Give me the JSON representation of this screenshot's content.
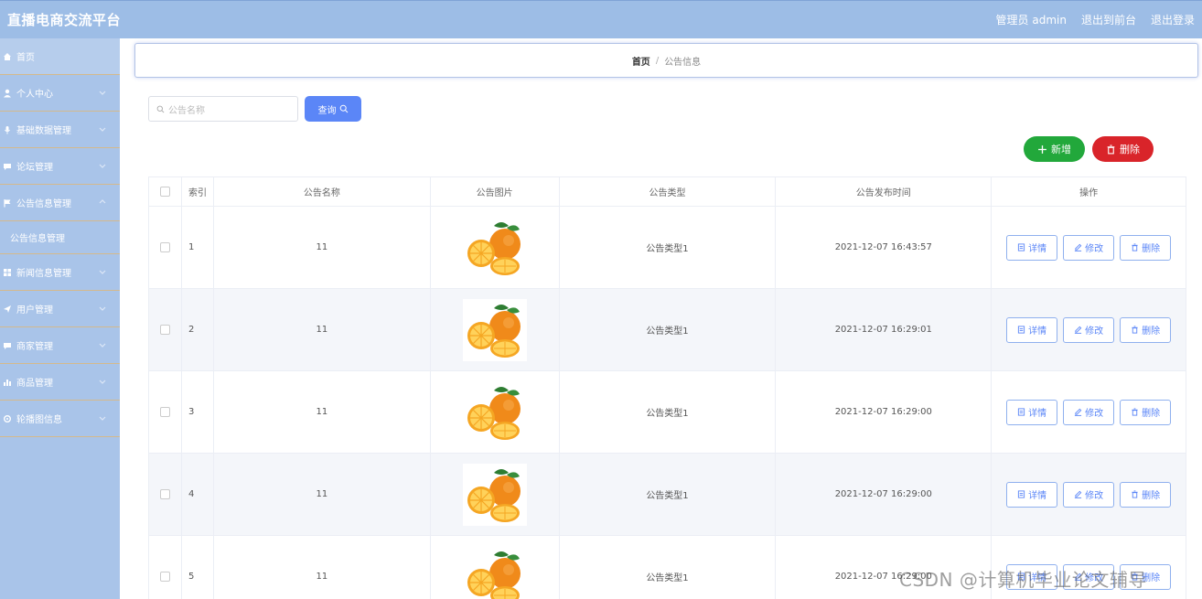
{
  "header": {
    "title": "直播电商交流平台",
    "admin_label": "管理员 admin",
    "to_front": "退出到前台",
    "logout": "退出登录"
  },
  "sidebar": {
    "items": [
      {
        "label": "首页",
        "icon": "home-icon"
      },
      {
        "label": "个人中心",
        "icon": "user-icon"
      },
      {
        "label": "基础数据管理",
        "icon": "mic-icon"
      },
      {
        "label": "论坛管理",
        "icon": "chat-icon"
      },
      {
        "label": "公告信息管理",
        "icon": "flag-icon"
      },
      {
        "label": "公告信息管理",
        "icon": ""
      },
      {
        "label": "新闻信息管理",
        "icon": "grid-icon"
      },
      {
        "label": "用户管理",
        "icon": "send-icon"
      },
      {
        "label": "商家管理",
        "icon": "chat-icon"
      },
      {
        "label": "商品管理",
        "icon": "bar-chart-icon"
      },
      {
        "label": "轮播图信息",
        "icon": "settings-icon"
      }
    ]
  },
  "breadcrumb": {
    "home": "首页",
    "sep": "/",
    "current": "公告信息"
  },
  "search": {
    "placeholder": "公告名称",
    "button": "查询"
  },
  "actions": {
    "add": "新增",
    "delete": "删除"
  },
  "table": {
    "headers": [
      "索引",
      "公告名称",
      "公告图片",
      "公告类型",
      "公告发布时间",
      "操作"
    ],
    "rows": [
      {
        "index": "1",
        "name": "11",
        "type": "公告类型1",
        "time": "2021-12-07 16:43:57"
      },
      {
        "index": "2",
        "name": "11",
        "type": "公告类型1",
        "time": "2021-12-07 16:29:01"
      },
      {
        "index": "3",
        "name": "11",
        "type": "公告类型1",
        "time": "2021-12-07 16:29:00"
      },
      {
        "index": "4",
        "name": "11",
        "type": "公告类型1",
        "time": "2021-12-07 16:29:00"
      },
      {
        "index": "5",
        "name": "11",
        "type": "公告类型1",
        "time": "2021-12-07 16:29:00"
      }
    ],
    "row_actions": {
      "detail": "详情",
      "edit": "修改",
      "delete": "删除"
    }
  },
  "watermark": "CSDN @计算机毕业论文辅导",
  "colors": {
    "topbar": "#9dbde6",
    "sidebar": "#a9c4e9",
    "primary": "#5b86f7",
    "success": "#22a83b",
    "danger": "#d9242a"
  }
}
